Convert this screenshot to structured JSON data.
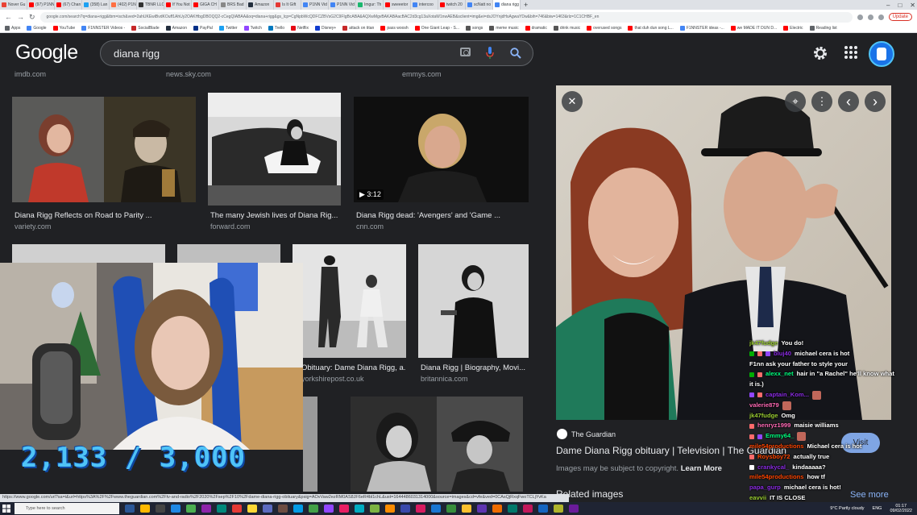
{
  "browser": {
    "tabs": [
      {
        "label": "Nover Gu",
        "color": "#ea4335"
      },
      {
        "label": "(97) P1NN",
        "color": "#ff0000"
      },
      {
        "label": "(67) Chan",
        "color": "#ff0000"
      },
      {
        "label": "(358) Lan",
        "color": "#1da1f2"
      },
      {
        "label": "(402) P1N",
        "color": "#ff7043"
      },
      {
        "label": "TBNR LLC",
        "color": "#333333"
      },
      {
        "label": "If You Not",
        "color": "#ff0000"
      },
      {
        "label": "GIGA CH",
        "color": "#ff0000"
      },
      {
        "label": "BRS Bad",
        "color": "#888888"
      },
      {
        "label": "Amazon",
        "color": "#232f3e"
      },
      {
        "label": "Is It Gift",
        "color": "#e53935"
      },
      {
        "label": "P1NN Vid",
        "color": "#4285f4"
      },
      {
        "label": "P1NN Vid",
        "color": "#4285f4"
      },
      {
        "label": "Imgur: Th",
        "color": "#1bb76e"
      },
      {
        "label": "sweeetor",
        "color": "#ff0000"
      },
      {
        "label": "intercoo",
        "color": "#4285f4"
      },
      {
        "label": "twitch 20",
        "color": "#ff0000"
      },
      {
        "label": "scNatt no",
        "color": "#4285f4"
      },
      {
        "label": "diana rigg",
        "color": "#4285f4",
        "active": true
      }
    ],
    "new_tab": "+",
    "window_controls": {
      "minimize": "–",
      "maximize": "□",
      "close": "✕"
    },
    "url": "google.com/search?q=diana+rigg&tbm=isch&ved=2ahUKEwiBvdKOuff1AhUy2OAKHbgDBOQQ2-cCegQIABAA&oq=diana+rigg&gs_lcp=CgNpbWcQDFCZBVsG2C9FIgBcABA&AQXwMgvBAKABAacBAC2d3cg13aXotaW1nwAEB&sclient=img&ei=dsJOYnjdHsAgwaYDw&bih=746&biw=1463&rlz=1C1CHBF_en",
    "update_label": "Update",
    "bookmarks": [
      {
        "label": "Apps",
        "color": "#5f6368"
      },
      {
        "label": "Google",
        "color": "#4285f4"
      },
      {
        "label": "YouTube",
        "color": "#ff0000"
      },
      {
        "label": "F1NNSTER Videos -",
        "color": "#4285f4"
      },
      {
        "label": "SocialBlade",
        "color": "#c62828"
      },
      {
        "label": "Amazon",
        "color": "#232f3e"
      },
      {
        "label": "PayPal",
        "color": "#003087"
      },
      {
        "label": "Twitter",
        "color": "#1da1f2"
      },
      {
        "label": "Twitch",
        "color": "#9146ff"
      },
      {
        "label": "Trello",
        "color": "#0079bf"
      },
      {
        "label": "Netflix",
        "color": "#e50914"
      },
      {
        "label": "Disney+",
        "color": "#113ccf"
      },
      {
        "label": "attack on titan",
        "color": "#c62828"
      },
      {
        "label": "pass woosh",
        "color": "#ff0000"
      },
      {
        "label": "One Giant Leap - S...",
        "color": "#ff0000"
      },
      {
        "label": "songs",
        "color": "#555555"
      },
      {
        "label": "meme music",
        "color": "#555555"
      },
      {
        "label": "dramatic",
        "color": "#ff0000"
      },
      {
        "label": "drink music",
        "color": "#555555"
      },
      {
        "label": "overused songs",
        "color": "#ff0000"
      },
      {
        "label": "that duh dun song L...",
        "color": "#ff0000"
      },
      {
        "label": "F1NNSTER ideas -...",
        "color": "#4285f4"
      },
      {
        "label": "we MADE IT DUN D...",
        "color": "#ff0000"
      },
      {
        "label": "Electric",
        "color": "#ff0000"
      },
      {
        "label": "Reading list",
        "color": "#5f6368"
      }
    ]
  },
  "google": {
    "logo": "Google",
    "query": "diana rigg"
  },
  "results": {
    "top_sources": [
      "imdb.com",
      "news.sky.com",
      "emmys.com"
    ],
    "row1": [
      {
        "caption": "Diana Rigg Reflects on Road to Parity ...",
        "source": "variety.com"
      },
      {
        "caption": "The many Jewish lives of Diana Rig...",
        "source": "forward.com"
      },
      {
        "caption": "Diana Rigg dead: 'Avengers' and 'Game ...",
        "source": "cnn.com",
        "duration": "3:12"
      }
    ],
    "row2": [
      {
        "caption": "Obituary: Dame Diana Rigg, a...",
        "source": "yorkshirepost.co.uk"
      },
      {
        "caption": "Diana Rigg | Biography, Movi...",
        "source": "britannica.com"
      }
    ]
  },
  "preview": {
    "source_name": "The Guardian",
    "title": "Dame Diana Rigg obituary | Television | The Guardian",
    "copyright": "Images may be subject to copyright.",
    "learn_more": "Learn More",
    "related": "Related images",
    "visit": "Visit",
    "more": "See more",
    "close_glyph": "✕",
    "prev_glyph": "‹",
    "next_glyph": "›",
    "more_glyph": "⋮"
  },
  "stream": {
    "counter": "2,133 / 3,000"
  },
  "chat": [
    {
      "user": "jk47fudge",
      "color": "#9acd32",
      "message": "You do!",
      "badges": []
    },
    {
      "user": "bluj40",
      "color": "#8a2be2",
      "message": "michael cera is hot",
      "badges": [
        "#00ad03",
        "#ff6b6b",
        "#9146ff"
      ]
    },
    {
      "user": "F1nn ask your father to style your",
      "color": "#ffffff",
      "message": "",
      "badges": [],
      "plain": true
    },
    {
      "user": "alexx_net",
      "color": "#00ff7f",
      "message": "hair in \"a Rachel\" he'll know what",
      "badges": [
        "#00ad03",
        "#ff6b6b"
      ]
    },
    {
      "user": "",
      "color": "#ffffff",
      "message": "it is.)",
      "badges": [],
      "plain": true
    },
    {
      "user": "captain_Kom...",
      "color": "#8a2be2",
      "message": "",
      "badges": [
        "#9146ff",
        "#ff6b6b"
      ],
      "emote": true
    },
    {
      "user": "valerie879",
      "color": "#ff69b4",
      "message": "",
      "badges": [],
      "emote": true
    },
    {
      "user": "jk47fudge",
      "color": "#9acd32",
      "message": "Omg",
      "badges": []
    },
    {
      "user": "henryz1999",
      "color": "#ff69b4",
      "message": "maisie williams",
      "badges": [
        "#ff6b6b"
      ]
    },
    {
      "user": "Emmy64_",
      "color": "#00ff7f",
      "message": "",
      "badges": [
        "#ff6b6b",
        "#9146ff"
      ],
      "emote": true
    },
    {
      "user": "mile54productions",
      "color": "#ff4500",
      "message": "Michael cera is hot",
      "badges": []
    },
    {
      "user": "Roysboy72",
      "color": "#ff4500",
      "message": "actually true",
      "badges": [
        "#ff6b6b"
      ]
    },
    {
      "user": "crankycal_",
      "color": "#8a2be2",
      "message": "kindaaaaa?",
      "badges": [
        "#ffffff"
      ]
    },
    {
      "user": "mile54productions",
      "color": "#ff4500",
      "message": "how tf",
      "badges": []
    },
    {
      "user": "papa_gurp",
      "color": "#8a2be2",
      "message": "michael cera is hot!",
      "badges": []
    },
    {
      "user": "eavvii",
      "color": "#9acd32",
      "message": "IT IS CLOSE",
      "badges": []
    }
  ],
  "status_url": "https://www.google.com/url?sa=i&url=https%3A%2F%2Fwww.theguardian.com%2Ftv-and-radio%2F2020%2Fsep%2F10%2Fdame-diana-rigg-obituary&psig=AOvVaw2ezRM0AS8JF6eR4bl1chL&ust=1644486031314000&source=images&cd=vfe&ved=0CAsQjRxqFwoTCLjYvKa",
  "taskbar": {
    "search_placeholder": "Type here to search",
    "weather": "9°C  Partly cloudy",
    "lang": "ENG",
    "time": "01:17",
    "date": "09/02/2022",
    "apps": [
      "#2b5797",
      "#ffb900",
      "#444444",
      "#1e88e5",
      "#4caf50",
      "#8e24aa",
      "#00897b",
      "#e53935",
      "#fdd835",
      "#5c6bc0",
      "#6d4c41",
      "#039be5",
      "#43a047",
      "#9146ff",
      "#e91e63",
      "#00acc1",
      "#7cb342",
      "#fb8c00",
      "#3949ab",
      "#d81b60",
      "#1976d2",
      "#388e3c",
      "#fbc02d",
      "#5e35b1",
      "#ef6c00",
      "#00796b",
      "#c2185b",
      "#1565c0",
      "#afb42b",
      "#6a1b9a"
    ]
  }
}
